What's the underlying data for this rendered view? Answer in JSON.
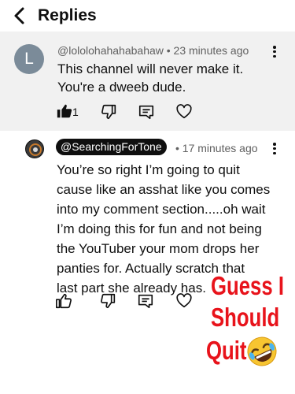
{
  "header": {
    "title": "Replies"
  },
  "parent_comment": {
    "avatar_letter": "L",
    "author": "@lololohahahabahaw",
    "time": " • 23 minutes ago",
    "text_line1": "This channel will never make it.",
    "text_line2": "You're a dweeb dude.",
    "like_count": "1"
  },
  "reply_comment": {
    "author": "@SearchingForTone",
    "time": " • 17 minutes ago",
    "lines": [
      "You’re so right I’m going to quit",
      "cause like an asshat like you comes",
      "into my comment section.....oh wait",
      "I’m doing this for fun and not being",
      "the YouTuber your mom drops her",
      "panties for. Actually scratch that",
      "last part she already has."
    ]
  },
  "overlay": {
    "line1": "Guess I",
    "line2": "Should",
    "line3": "Quit",
    "emoji": "rolling-on-floor-laughing-emoji"
  },
  "colors": {
    "overlay_red": "#e8131b",
    "parent_bg": "#f1f1f1",
    "avatar_grey": "#7b8b99"
  }
}
